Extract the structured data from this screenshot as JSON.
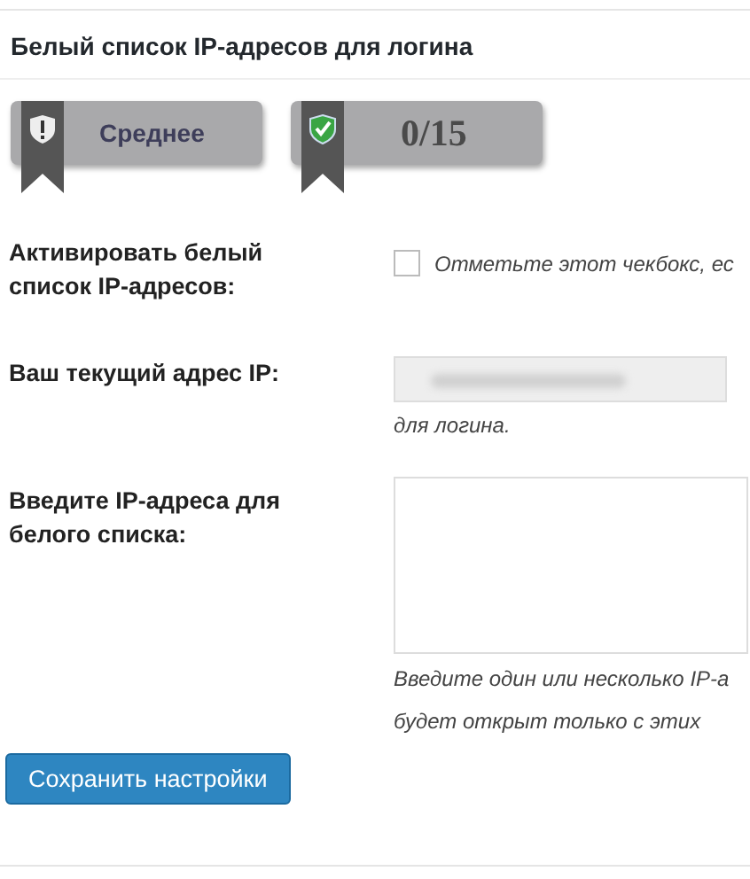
{
  "panel": {
    "title": "Белый список IP-адресов для логина"
  },
  "badges": [
    {
      "kind": "warning",
      "text": "Среднее"
    },
    {
      "kind": "ok",
      "text": "0/15"
    }
  ],
  "settings": [
    {
      "kind": "checkbox",
      "label": "Активировать белый список IP-адресов:",
      "checked": false,
      "hint": "Отметьте этот чекбокс, ес"
    },
    {
      "kind": "readonly",
      "label": "Ваш текущий адрес IP:",
      "note": "для логина."
    },
    {
      "kind": "textarea",
      "label": "Введите IP-адреса для белого списка:",
      "help": [
        "Введите один или несколько IP-а",
        "будет открыт только с этих"
      ]
    }
  ],
  "save_button": "Сохранить настройки"
}
